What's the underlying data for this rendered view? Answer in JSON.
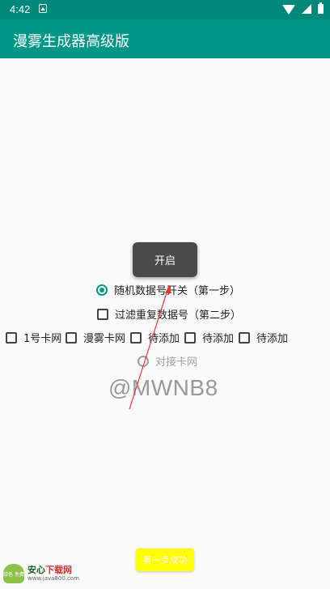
{
  "status_bar": {
    "time": "4:42"
  },
  "app_bar": {
    "title": "漫雾生成器高级版"
  },
  "start_button": {
    "label": "开启"
  },
  "options": {
    "random_number": "随机数据号开关（第一步）",
    "filter_dupes": "过滤重复数据号（第二步）",
    "interface": "对接卡网"
  },
  "checkbox_row": [
    "1号卡网",
    "漫雾卡网",
    "待添加",
    "待添加",
    "待添加"
  ],
  "watermark": "@MWNB8",
  "success_button": {
    "label": "第一步成功"
  },
  "logo": {
    "badge": "绿色 免费",
    "part1": "安心",
    "part2": "下载网",
    "url": "www.java800.com"
  },
  "colors": {
    "primary": "#009688",
    "status": "#00897b",
    "accent_button": "#ffff00"
  }
}
